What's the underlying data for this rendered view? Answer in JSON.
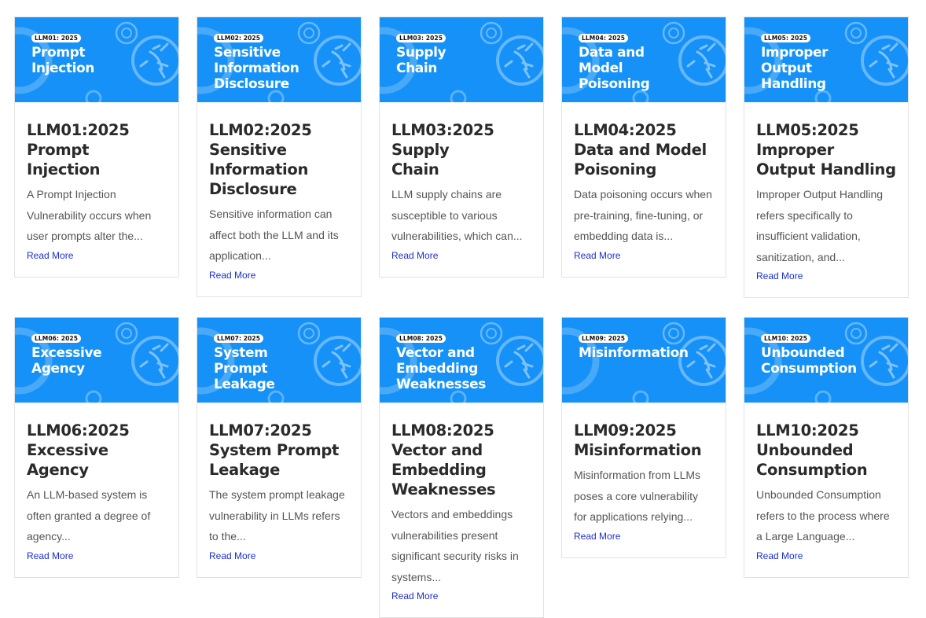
{
  "cards": [
    {
      "badge": "LLM01: 2025",
      "banner_title": "Prompt Injection",
      "title": "LLM01:2025 Prompt Injection",
      "desc": "A Prompt Injection Vulnerability occurs when user prompts alter the...",
      "more": "Read More"
    },
    {
      "badge": "LLM02: 2025",
      "banner_title": "Sensitive Information Disclosure",
      "title": "LLM02:2025 Sensitive Information Disclosure",
      "desc": "Sensitive information can affect both the LLM and its application...",
      "more": "Read More"
    },
    {
      "badge": "LLM03: 2025",
      "banner_title": "Supply Chain",
      "title": "LLM03:2025 Supply Chain",
      "desc": "LLM supply chains are susceptible to various vulnerabilities, which can...",
      "more": "Read More"
    },
    {
      "badge": "LLM04: 2025",
      "banner_title": "Data and Model Poisoning",
      "title": "LLM04:2025 Data and Model Poisoning",
      "desc": "Data poisoning occurs when pre-training, fine-tuning, or embedding data is...",
      "more": "Read More"
    },
    {
      "badge": "LLM05: 2025",
      "banner_title": "Improper Output Handling",
      "title": "LLM05:2025 Improper Output Handling",
      "desc": "Improper Output Handling refers specifically to insufficient validation, sanitization, and...",
      "more": "Read More"
    },
    {
      "badge": "LLM06: 2025",
      "banner_title": "Excessive Agency",
      "title": "LLM06:2025 Excessive Agency",
      "desc": "An LLM-based system is often granted a degree of agency...",
      "more": "Read More"
    },
    {
      "badge": "LLM07: 2025",
      "banner_title": "System Prompt Leakage",
      "title": "LLM07:2025 System Prompt Leakage",
      "desc": "The system prompt leakage vulnerability in LLMs refers to the...",
      "more": "Read More"
    },
    {
      "badge": "LLM08: 2025",
      "banner_title": "Vector and Embedding Weaknesses",
      "title": "LLM08:2025 Vector and Embedding Weaknesses",
      "desc": "Vectors and embeddings vulnerabilities present significant security risks in systems...",
      "more": "Read More"
    },
    {
      "badge": "LLM09: 2025",
      "banner_title": "Misinformation",
      "title": "LLM09:2025 Misinformation",
      "desc": "Misinformation from LLMs poses a core vulnerability for applications relying...",
      "more": "Read More"
    },
    {
      "badge": "LLM10: 2025",
      "banner_title": "Unbounded Consumption",
      "title": "LLM10:2025 Unbounded Consumption",
      "desc": "Unbounded Consumption refers to the process where a Large Language...",
      "more": "Read More"
    }
  ],
  "colors": {
    "banner": "#1591f7",
    "link": "#1b2fd1",
    "title": "#2a2a2a",
    "text": "#555555"
  },
  "icons": {
    "banner_logo": "wasp-logo-icon"
  }
}
